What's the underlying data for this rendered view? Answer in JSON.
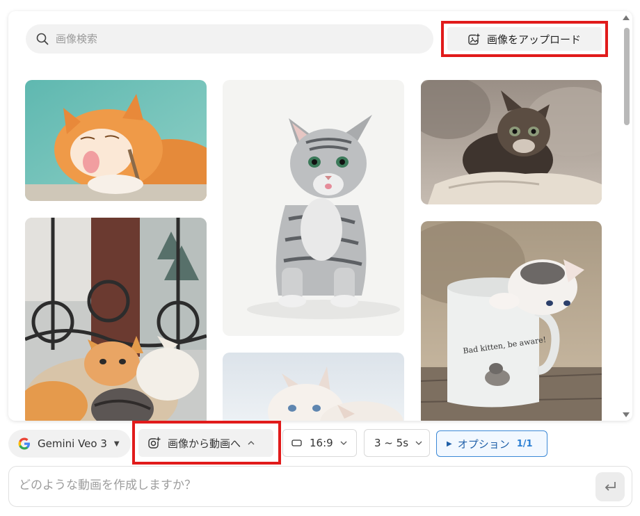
{
  "search": {
    "placeholder": "画像検索"
  },
  "upload": {
    "label": "画像をアップロード"
  },
  "toolbar": {
    "model": {
      "label": "Gemini Veo 3"
    },
    "mode": {
      "label": "画像から動画へ"
    },
    "aspect": {
      "label": "16:9"
    },
    "duration": {
      "label": "3 ~ 5s"
    },
    "options": {
      "label": "オプション",
      "count": "1/1"
    }
  },
  "prompt": {
    "placeholder": "どのような動画を作成しますか？"
  },
  "colors": {
    "highlight": "#e11b1b",
    "accent": "#2b7fd4"
  },
  "images": [
    {
      "name": "orange-cat-licking"
    },
    {
      "name": "silver-tabby-cat"
    },
    {
      "name": "fluffy-kitten-on-rock"
    },
    {
      "name": "kittens-by-iron-gate"
    },
    {
      "name": "white-kittens"
    },
    {
      "name": "kitten-in-mug"
    }
  ]
}
